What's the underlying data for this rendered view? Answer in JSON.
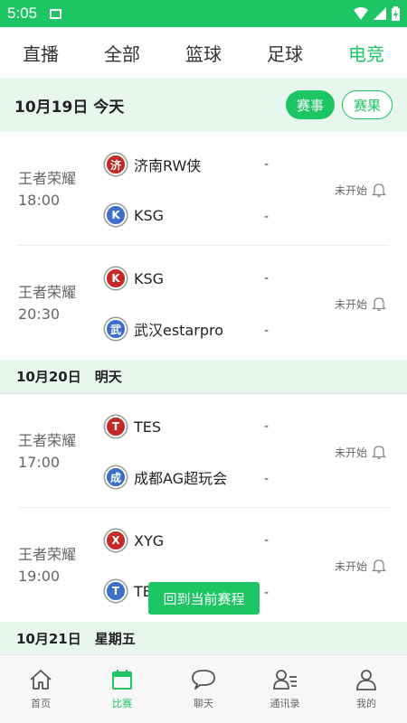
{
  "statusbar": {
    "time": "5:05"
  },
  "tabs": [
    {
      "label": "直播"
    },
    {
      "label": "全部"
    },
    {
      "label": "篮球"
    },
    {
      "label": "足球"
    },
    {
      "label": "电竞"
    }
  ],
  "header": {
    "date": "10月19日 今天",
    "btn_events": "赛事",
    "btn_results": "赛果"
  },
  "days": [
    {
      "matches": [
        {
          "game": "王者荣耀",
          "time": "18:00",
          "team1": {
            "name": "济南RW侠",
            "badge": "济",
            "color": "#c62828"
          },
          "team2": {
            "name": "KSG",
            "badge": "K",
            "color": "#3c6fc9"
          },
          "score1": "-",
          "score2": "-",
          "status": "未开始"
        },
        {
          "game": "王者荣耀",
          "time": "20:30",
          "team1": {
            "name": "KSG",
            "badge": "K",
            "color": "#c62828"
          },
          "team2": {
            "name": "武汉estarpro",
            "badge": "武",
            "color": "#3c6fc9"
          },
          "score1": "-",
          "score2": "-",
          "status": "未开始"
        }
      ]
    },
    {
      "date": "10月20日　明天",
      "matches": [
        {
          "game": "王者荣耀",
          "time": "17:00",
          "team1": {
            "name": "TES",
            "badge": "T",
            "color": "#c62828"
          },
          "team2": {
            "name": "成都AG超玩会",
            "badge": "成",
            "color": "#3c6fc9"
          },
          "score1": "-",
          "score2": "-",
          "status": "未开始"
        },
        {
          "game": "王者荣耀",
          "time": "19:00",
          "team1": {
            "name": "XYG",
            "badge": "X",
            "color": "#c62828"
          },
          "team2": {
            "name": "TES",
            "badge": "T",
            "color": "#3c6fc9"
          },
          "score1": "-",
          "score2": "-",
          "status": "未开始"
        }
      ]
    },
    {
      "date": "10月21日　星期五"
    }
  ],
  "float_button": "回到当前赛程",
  "bottom_nav": [
    {
      "label": "首页",
      "icon": "home-icon"
    },
    {
      "label": "比赛",
      "icon": "calendar-icon"
    },
    {
      "label": "聊天",
      "icon": "chat-icon"
    },
    {
      "label": "通讯录",
      "icon": "contacts-icon"
    },
    {
      "label": "我的",
      "icon": "profile-icon"
    }
  ],
  "colors": {
    "accent": "#1ec564",
    "header_bg": "#e8f7ee"
  }
}
